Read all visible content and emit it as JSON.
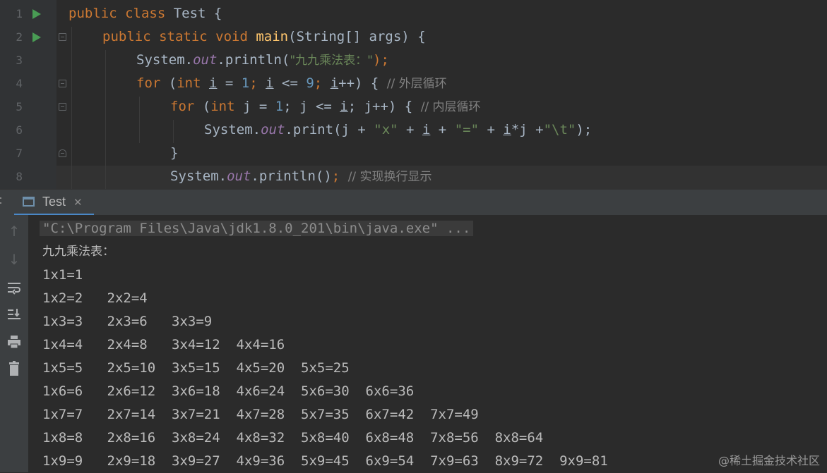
{
  "editor": {
    "line_numbers": [
      "1",
      "2",
      "3",
      "4",
      "5",
      "6",
      "7",
      "8"
    ],
    "line1": {
      "kw": "public class",
      "name": " Test {"
    },
    "line2": {
      "kw": "public static void",
      "fn": "main",
      "rest": "(String[] args) {"
    },
    "line3": {
      "a": "System.",
      "b": "out",
      "c": ".println(",
      "d": "\"九九乘法表：\"",
      "e": ");"
    },
    "line4": {
      "a": "for",
      "b": " (",
      "c": "int",
      "d": " ",
      "e": "i",
      "f": " = ",
      "g": "1",
      "h": "; ",
      "i": "i",
      "j": " <= ",
      "k": "9",
      "l": "; ",
      "m": "i",
      "n": "++) { ",
      "o": "// 外层循环"
    },
    "line5": {
      "a": "for",
      "b": " (",
      "c": "int",
      "d": " j = ",
      "e": "1",
      "f": "; j <= ",
      "g": "i",
      "h": "; j++) { ",
      "i": "// 内层循环"
    },
    "line6": {
      "a": "System.",
      "b": "out",
      "c": ".print(j + ",
      "d": "\"x\"",
      "e": " + ",
      "f": "i",
      "g": " + ",
      "h": "\"=\"",
      "i": " + ",
      "j": "i",
      "k": "*j +",
      "l": "\"\\t\"",
      "m": ");"
    },
    "line7": {
      "a": "}"
    },
    "line8": {
      "a": "System.",
      "b": "out",
      "c": ".println()",
      "d": "; ",
      "e": "// 实现换行显示"
    }
  },
  "run_panel": {
    "tab_label": "Test",
    "tab_close": "✕",
    "tab_icon": "console-window-icon",
    "toolbar_icons": [
      "arrow-up-icon",
      "arrow-down-icon",
      "soft-wrap-icon",
      "scroll-to-end-icon",
      "print-icon",
      "trash-icon"
    ]
  },
  "console": {
    "command": "\"C:\\Program Files\\Java\\jdk1.8.0_201\\bin\\java.exe\" ...",
    "title": "九九乘法表：",
    "rows": [
      "1x1=1",
      "1x2=2   2x2=4",
      "1x3=3   2x3=6   3x3=9",
      "1x4=4   2x4=8   3x4=12  4x4=16",
      "1x5=5   2x5=10  3x5=15  4x5=20  5x5=25",
      "1x6=6   2x6=12  3x6=18  4x6=24  5x6=30  6x6=36",
      "1x7=7   2x7=14  3x7=21  4x7=28  5x7=35  6x7=42  7x7=49",
      "1x8=8   2x8=16  3x8=24  4x8=32  5x8=40  6x8=48  7x8=56  8x8=64",
      "1x9=9   2x9=18  3x9=27  4x9=36  5x9=45  6x9=54  7x9=63  8x9=72  9x9=81"
    ]
  },
  "watermark": "@稀土掘金技术社区",
  "colors": {
    "keyword": "#cc7832",
    "string": "#6a8759",
    "number": "#6897bb",
    "field": "#9876aa",
    "method": "#ffc66d",
    "comment": "#808080",
    "tab_underline": "#4a88c7"
  }
}
